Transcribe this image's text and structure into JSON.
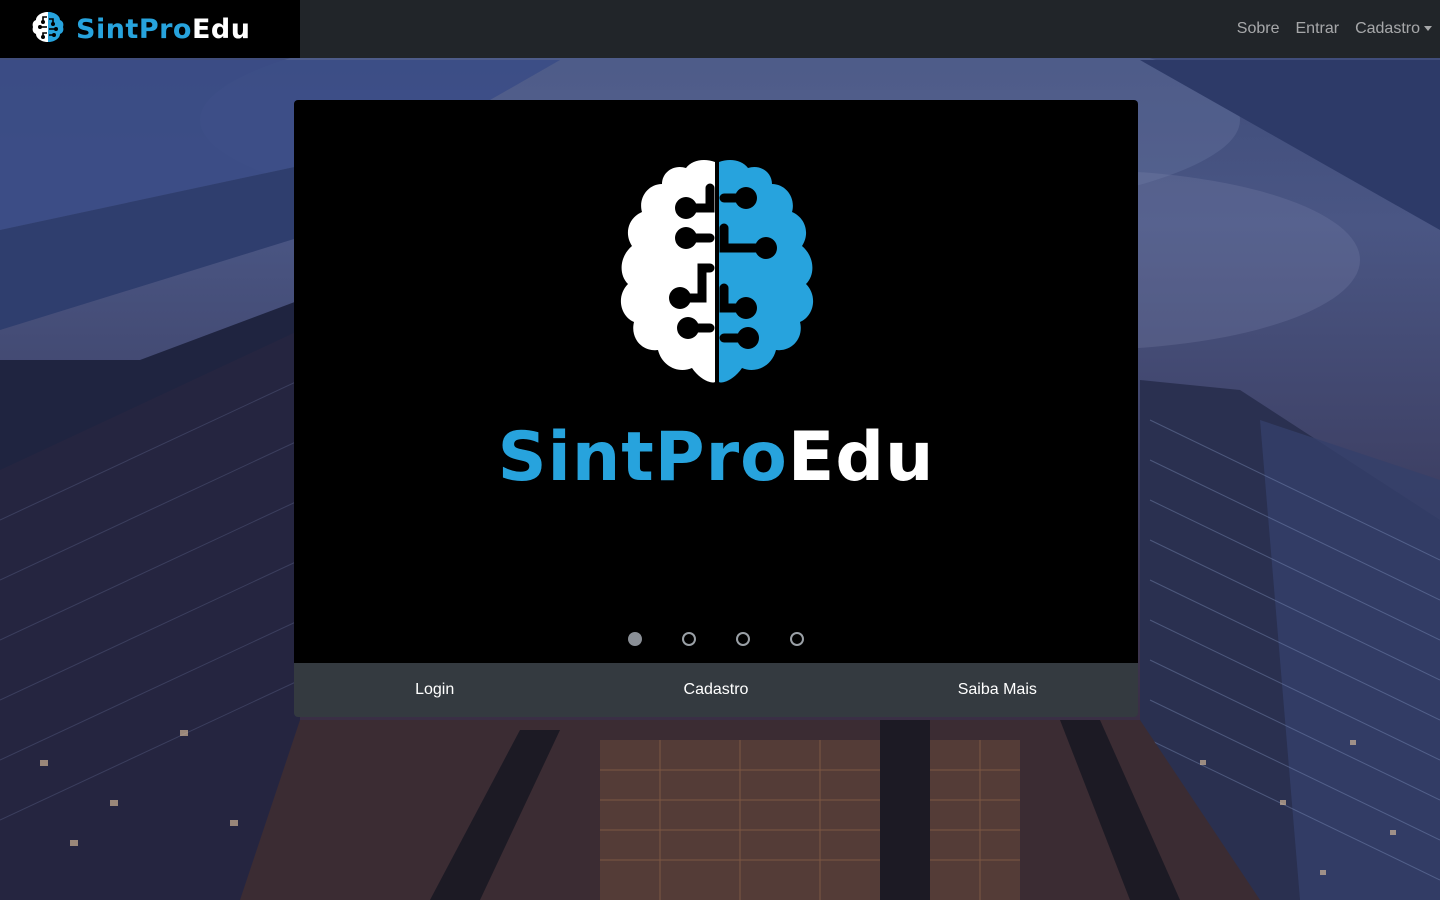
{
  "brand": {
    "name_part1": "SintPro",
    "name_part2": "Edu",
    "logo_icon": "brain-circuit-icon"
  },
  "nav": {
    "items": [
      {
        "label": "Sobre"
      },
      {
        "label": "Entrar"
      },
      {
        "label": "Cadastro",
        "has_dropdown": true
      }
    ]
  },
  "carousel": {
    "slide_title_part1": "SintPro",
    "slide_title_part2": "Edu",
    "slide_count": 4,
    "active_index": 0
  },
  "footer": {
    "buttons": [
      {
        "label": "Login"
      },
      {
        "label": "Cadastro"
      },
      {
        "label": "Saiba Mais"
      }
    ]
  },
  "colors": {
    "navbar": "#212529",
    "brand_bg": "#000000",
    "accent_blue": "#27a3dd",
    "footer_bg": "#343a40"
  }
}
